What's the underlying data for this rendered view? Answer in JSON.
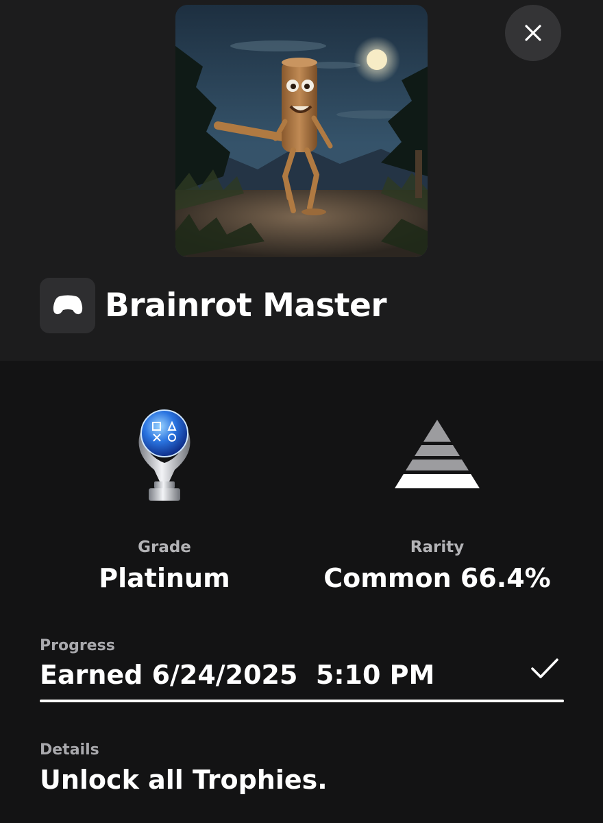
{
  "trophy": {
    "title": "Brainrot Master",
    "artwork_icon": "game-artwork-image",
    "game_icon": "gamepad-icon"
  },
  "close_button": {
    "icon": "close-icon"
  },
  "grade": {
    "label": "Grade",
    "value": "Platinum",
    "icon": "platinum-trophy-icon"
  },
  "rarity": {
    "label": "Rarity",
    "value": "Common 66.4%",
    "icon": "rarity-pyramid-icon"
  },
  "progress": {
    "label": "Progress",
    "value": "Earned 6/24/2025  5:10 PM",
    "status_icon": "checkmark-icon",
    "fraction": 1.0
  },
  "details": {
    "label": "Details",
    "value": "Unlock all Trophies."
  },
  "colors": {
    "background": "#131314",
    "header_background": "#1c1c1d",
    "label_gray": "#b3b3b6",
    "text": "#ffffff"
  }
}
